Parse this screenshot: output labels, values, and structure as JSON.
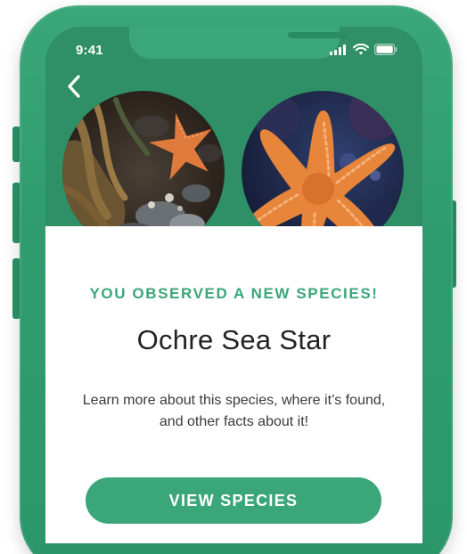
{
  "status_bar": {
    "time": "9:41",
    "icons": [
      "cellular-signal-icon",
      "wifi-icon",
      "battery-icon"
    ]
  },
  "nav": {
    "back_icon": "chevron-left-icon"
  },
  "photos": [
    {
      "subject": "ochre-sea-star-in-seaweed"
    },
    {
      "subject": "ochre-sea-star-on-rock"
    }
  ],
  "card": {
    "eyebrow": "YOU OBSERVED A NEW SPECIES!",
    "species_name": "Ochre Sea Star",
    "description": "Learn more about this species, where it’s found, and other facts about it!",
    "cta_label": "VIEW SPECIES"
  },
  "colors": {
    "brand_green": "#3aa67a",
    "header_green": "#2f8f66",
    "starfish_orange": "#e7853a"
  }
}
